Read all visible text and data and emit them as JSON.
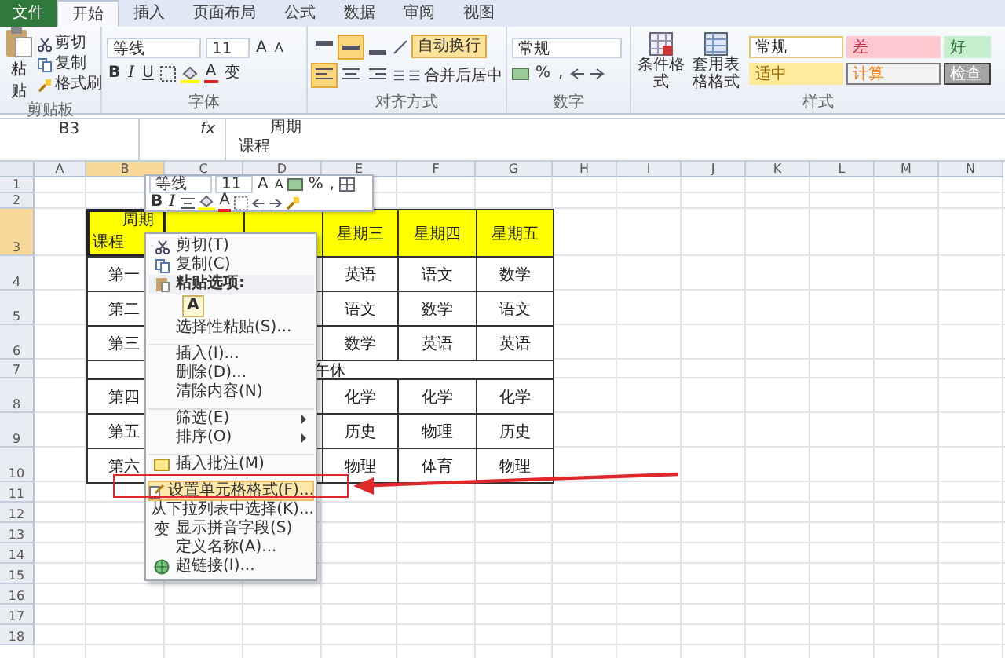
{
  "tabs": [
    {
      "label": "文件",
      "kind": "file",
      "selected": false
    },
    {
      "label": "开始",
      "kind": "tab",
      "selected": true
    },
    {
      "label": "插入",
      "kind": "tab",
      "selected": false
    },
    {
      "label": "页面布局",
      "kind": "tab",
      "selected": false
    },
    {
      "label": "公式",
      "kind": "tab",
      "selected": false
    },
    {
      "label": "数据",
      "kind": "tab",
      "selected": false
    },
    {
      "label": "审阅",
      "kind": "tab",
      "selected": false
    },
    {
      "label": "视图",
      "kind": "tab",
      "selected": false
    }
  ],
  "clipboard": {
    "paste": "粘贴",
    "actions": [
      {
        "label": "剪切",
        "kind": "cut"
      },
      {
        "label": "复制",
        "kind": "copy"
      },
      {
        "label": "格式刷",
        "kind": "brush"
      }
    ],
    "label": "剪贴板"
  },
  "font": {
    "name": "等线",
    "size": "11",
    "grow": "A",
    "shrink": "A",
    "styles": [
      "B",
      "I",
      "U"
    ],
    "color_letter": "A",
    "phonetic": "变",
    "label": "字体"
  },
  "alignment": {
    "vertical": [
      {
        "selected": false
      },
      {
        "selected": true
      },
      {
        "selected": false
      }
    ],
    "horizontal": [
      {
        "selected": true
      },
      {
        "selected": false
      },
      {
        "selected": false
      }
    ],
    "wrap": {
      "label": "自动换行",
      "selected": true
    },
    "merge": "合并后居中",
    "label": "对齐方式"
  },
  "number": {
    "format": "常规",
    "percent": "%",
    "comma": ",",
    "label": "数字"
  },
  "styles": {
    "conditional": "条件格式",
    "table": "套用表格格式",
    "label": "样式",
    "cells": [
      {
        "label": "常规",
        "kind": "normal"
      },
      {
        "label": "差",
        "kind": "bad"
      },
      {
        "label": "好",
        "kind": "good"
      },
      {
        "label": "适中",
        "kind": "neutral"
      },
      {
        "label": "计算",
        "kind": "calc"
      },
      {
        "label": "检查",
        "kind": "check"
      }
    ]
  },
  "formula_bar": {
    "name_box": "B3",
    "function_label": "fx",
    "content": [
      "周期",
      "课程"
    ]
  },
  "columns": [
    {
      "label": "A",
      "selected": false
    },
    {
      "label": "B",
      "selected": true
    },
    {
      "label": "C",
      "selected": false
    },
    {
      "label": "D",
      "selected": false
    },
    {
      "label": "E",
      "selected": false
    },
    {
      "label": "F",
      "selected": false
    },
    {
      "label": "G",
      "selected": false
    },
    {
      "label": "H",
      "selected": false
    },
    {
      "label": "I",
      "selected": false
    },
    {
      "label": "J",
      "selected": false
    },
    {
      "label": "K",
      "selected": false
    },
    {
      "label": "L",
      "selected": false
    },
    {
      "label": "M",
      "selected": false
    },
    {
      "label": "N",
      "selected": false
    }
  ],
  "row_numbers": [
    {
      "label": "1",
      "selected": false
    },
    {
      "label": "2",
      "selected": false
    },
    {
      "label": "3",
      "selected": true
    },
    {
      "label": "4",
      "selected": false
    },
    {
      "label": "5",
      "selected": false
    },
    {
      "label": "6",
      "selected": false
    },
    {
      "label": "7",
      "selected": false
    },
    {
      "label": "8",
      "selected": false
    },
    {
      "label": "9",
      "selected": false
    },
    {
      "label": "10",
      "selected": false
    },
    {
      "label": "11",
      "selected": false
    },
    {
      "label": "12",
      "selected": false
    },
    {
      "label": "13",
      "selected": false
    },
    {
      "label": "14",
      "selected": false
    },
    {
      "label": "15",
      "selected": false
    },
    {
      "label": "16",
      "selected": false
    },
    {
      "label": "17",
      "selected": false
    },
    {
      "label": "18",
      "selected": false
    }
  ],
  "table": {
    "corner_top": "周期",
    "corner_bottom": "课程",
    "days": [
      "星期三",
      "星期四",
      "星期五"
    ],
    "rows": [
      {
        "kind": "lesson",
        "period": "第一",
        "subjects": [
          "英语",
          "语文",
          "数学"
        ]
      },
      {
        "kind": "lesson",
        "period": "第二",
        "subjects": [
          "语文",
          "数学",
          "语文"
        ]
      },
      {
        "kind": "lesson",
        "period": "第三",
        "subjects": [
          "数学",
          "英语",
          "英语"
        ]
      },
      {
        "kind": "break",
        "label": "午休"
      },
      {
        "kind": "lesson",
        "period": "第四",
        "subjects": [
          "化学",
          "化学",
          "化学"
        ]
      },
      {
        "kind": "lesson",
        "period": "第五",
        "subjects": [
          "历史",
          "物理",
          "历史"
        ]
      },
      {
        "kind": "lesson",
        "period": "第六",
        "subjects": [
          "物理",
          "体育",
          "物理"
        ]
      }
    ]
  },
  "mini_toolbar": {
    "font": "等线",
    "size": "11",
    "grow": "A",
    "shrink": "A",
    "percent": "%",
    "comma": ",",
    "bold": "B",
    "italic": "I",
    "color_letter": "A"
  },
  "context_menu": [
    {
      "kind": "cut",
      "label": "剪切(T)",
      "selected": false,
      "divider": false,
      "submenu": false
    },
    {
      "kind": "copy",
      "label": "复制(C)",
      "selected": false,
      "divider": false,
      "submenu": false
    },
    {
      "kind": "paste_header",
      "label": "粘贴选项:",
      "selected": false,
      "divider": false,
      "submenu": false
    },
    {
      "kind": "paste_option",
      "label": "A",
      "selected": false,
      "divider": false,
      "submenu": false
    },
    {
      "kind": "plain",
      "label": "选择性粘贴(S)...",
      "selected": false,
      "divider": false,
      "submenu": false
    },
    {
      "kind": "plain",
      "label": "插入(I)...",
      "selected": false,
      "divider": true,
      "submenu": false
    },
    {
      "kind": "plain",
      "label": "删除(D)...",
      "selected": false,
      "divider": false,
      "submenu": false
    },
    {
      "kind": "plain",
      "label": "清除内容(N)",
      "selected": false,
      "divider": false,
      "submenu": false
    },
    {
      "kind": "plain",
      "label": "筛选(E)",
      "selected": false,
      "divider": true,
      "submenu": true
    },
    {
      "kind": "plain",
      "label": "排序(O)",
      "selected": false,
      "divider": false,
      "submenu": true
    },
    {
      "kind": "comment",
      "label": "插入批注(M)",
      "selected": false,
      "divider": true,
      "submenu": false
    },
    {
      "kind": "format",
      "label": "设置单元格格式(F)...",
      "selected": true,
      "divider": true,
      "submenu": false
    },
    {
      "kind": "plain",
      "label": "从下拉列表中选择(K)...",
      "selected": false,
      "divider": false,
      "submenu": false
    },
    {
      "kind": "phonetic",
      "label": "显示拼音字段(S)",
      "glyph": "变",
      "selected": false,
      "divider": false,
      "submenu": false
    },
    {
      "kind": "plain",
      "label": "定义名称(A)...",
      "selected": false,
      "divider": false,
      "submenu": false
    },
    {
      "kind": "link",
      "label": "超链接(I)...",
      "selected": false,
      "divider": false,
      "submenu": false
    }
  ]
}
